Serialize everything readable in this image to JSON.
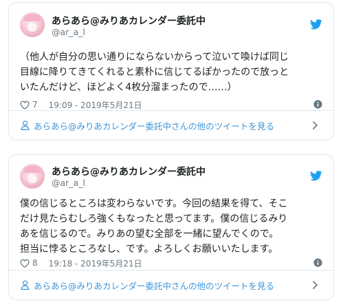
{
  "colors": {
    "twitter_blue": "#1da1f2",
    "link_blue": "#3b94d9",
    "meta_gray": "#697882",
    "border": "#e1e8ed"
  },
  "tweets": [
    {
      "display_name": "あらあら@みりあカレンダー委託中",
      "handle": "@ar_a_l",
      "lines": [
        "（他人が自分の思い通りにならないからって泣いて喚けば同じ",
        "目線に降りてきてくれると素朴に信じてるぽかったので放っと",
        "いたんだけど、ほどよく4枚分溜まったので……）"
      ],
      "likes": "7",
      "timestamp": "19:09 - 2019年5月21日",
      "footer_link": "あらあら@みりあカレンダー委託中さんの他のツイートを見る",
      "icons": [
        "avatar",
        "twitter-bird-icon",
        "heart-icon",
        "info-icon",
        "user-icon",
        "chevron-right-icon"
      ]
    },
    {
      "display_name": "あらあら@みりあカレンダー委託中",
      "handle": "@ar_a_l",
      "lines": [
        "僕の信じるところは変わらないです。今回の結果を得て、そこ",
        "だけ見たらむしろ強くもなったと思ってます。僕の信じるみり",
        "あを信じるので。みりあの望む全部を一緒に望んでくので。",
        "担当に悖るところなし、です。よろしくお願いいたします。"
      ],
      "likes": "8",
      "timestamp": "19:18 - 2019年5月21日",
      "footer_link": "あらあら@みりあカレンダー委託中さんの他のツイートを見る",
      "icons": [
        "avatar",
        "twitter-bird-icon",
        "heart-icon",
        "info-icon",
        "user-icon",
        "chevron-right-icon"
      ]
    }
  ]
}
